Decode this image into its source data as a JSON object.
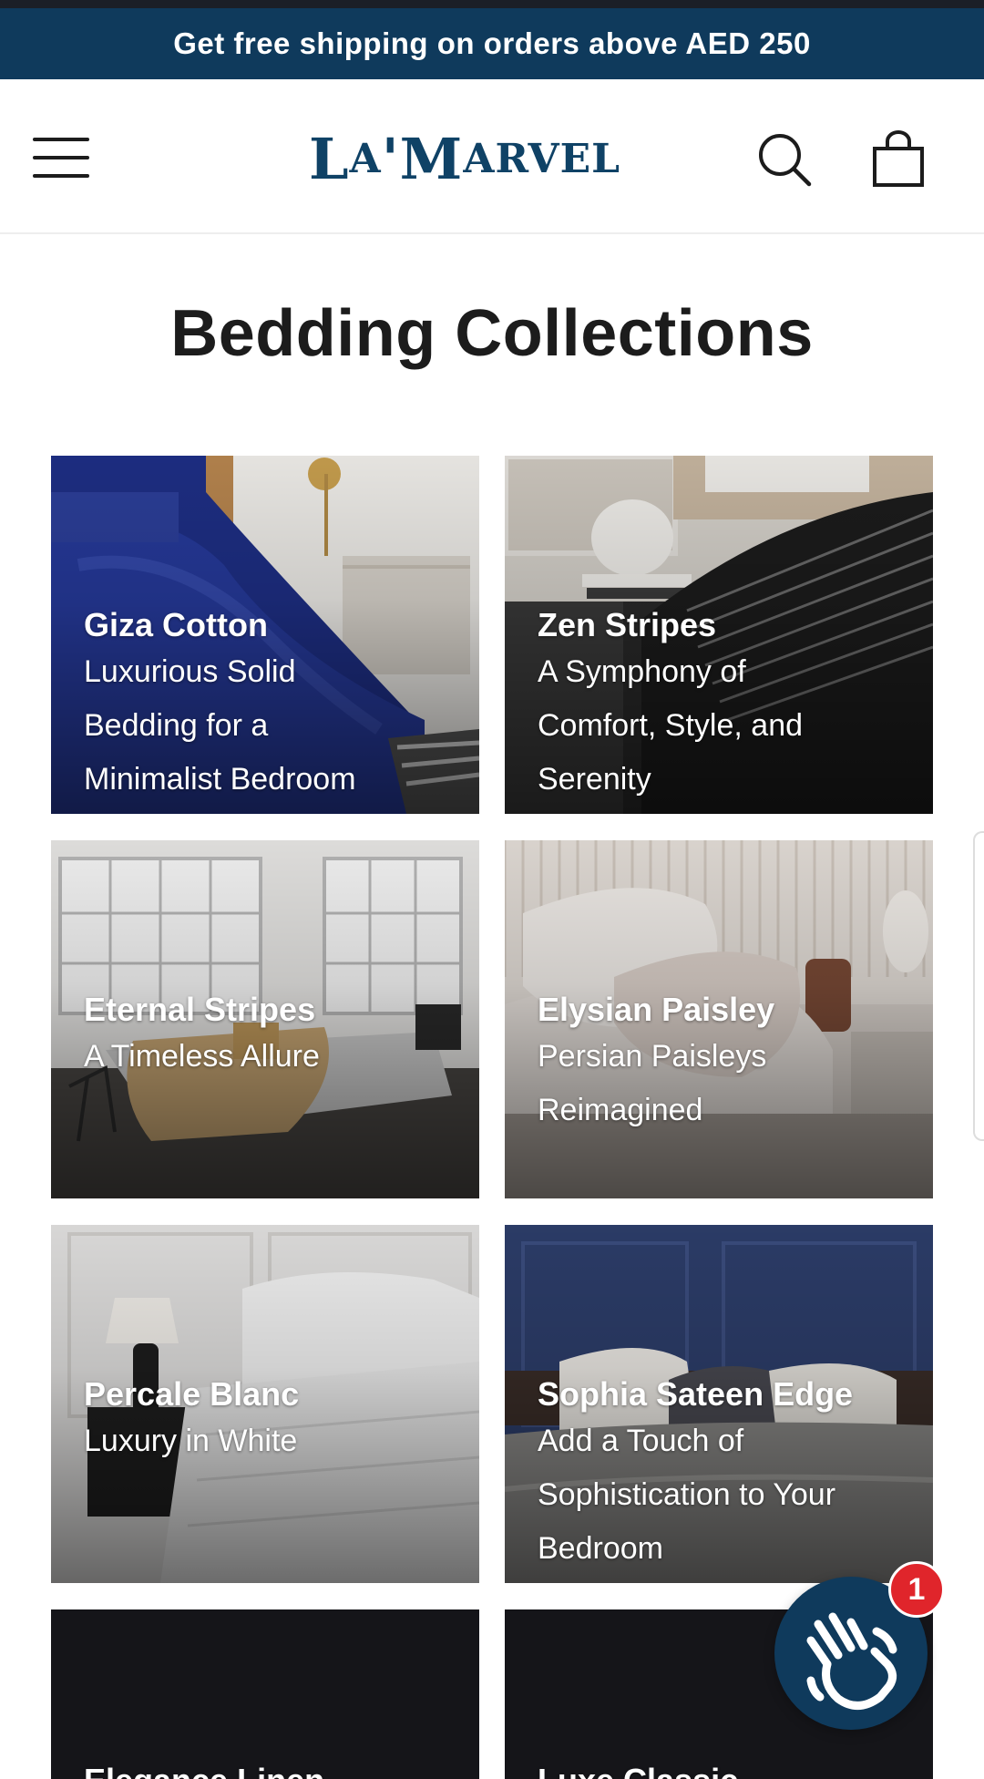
{
  "announcement": {
    "text": "Get free shipping on orders above AED 250"
  },
  "header": {
    "logo": {
      "part1": "L",
      "part2": "A",
      "part3": "'M",
      "part4": "ARVEL"
    }
  },
  "page": {
    "title": "Bedding Collections"
  },
  "collections": [
    {
      "title": "Giza Cotton",
      "subtitle_lines": [
        "Luxurious Solid",
        "Bedding for a",
        "Minimalist Bedroom"
      ]
    },
    {
      "title": "Zen Stripes",
      "subtitle_lines": [
        "A Symphony of",
        "Comfort, Style, and",
        "Serenity"
      ]
    },
    {
      "title": "Eternal Stripes",
      "subtitle_lines": [
        "A Timeless Allure"
      ]
    },
    {
      "title": "Elysian Paisley",
      "subtitle_lines": [
        "Persian Paisleys",
        "Reimagined"
      ]
    },
    {
      "title": "Percale Blanc",
      "subtitle_lines": [
        "Luxury in White"
      ]
    },
    {
      "title": "Sophia Sateen Edge",
      "subtitle_lines": [
        "Add a Touch of",
        "Sophistication to Your",
        "Bedroom"
      ]
    },
    {
      "title": "Elegance Linen",
      "subtitle_lines": []
    },
    {
      "title": "Luxe Classic",
      "subtitle_lines": []
    }
  ],
  "chat": {
    "badge_count": "1"
  },
  "colors": {
    "brand_navy": "#0f3a5c",
    "badge_red": "#e0252b"
  },
  "icons": {
    "menu": "hamburger-icon",
    "search": "search-icon",
    "cart": "shopping-bag-icon",
    "chat": "waving-hand-icon"
  }
}
